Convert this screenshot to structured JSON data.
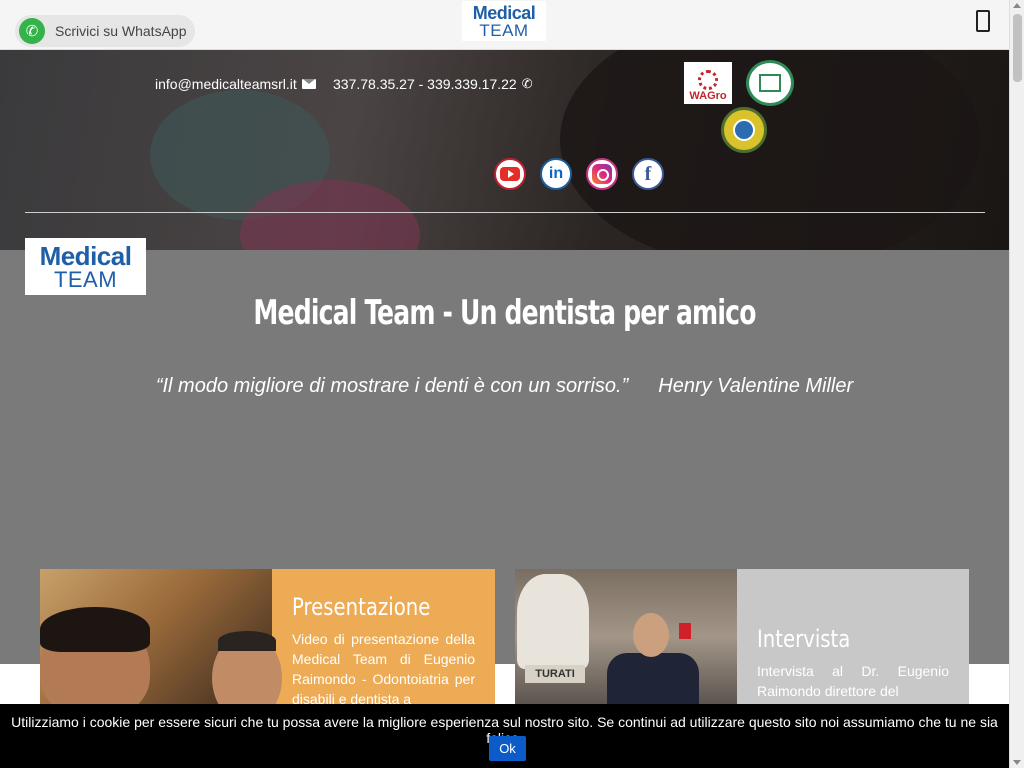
{
  "topbar": {
    "whatsapp_label": "Scrivici su WhatsApp",
    "logo": {
      "line1": "Medical",
      "line2": "TEAM"
    }
  },
  "hero": {
    "email": "info@medicalteamsrl.it",
    "phone": "337.78.35.27 - 339.339.17.22",
    "badges": {
      "wagro": "WAGro"
    },
    "social": [
      "youtube-icon",
      "linkedin-icon",
      "instagram-icon",
      "facebook-icon"
    ],
    "social_glyphs": {
      "linkedin": "in",
      "facebook": "f"
    }
  },
  "main": {
    "side_logo": {
      "line1": "Medical",
      "line2": "TEAM"
    },
    "title": "Medical Team - Un dentista per amico",
    "quote": "“Il modo migliore di mostrare i denti è con un sorriso.”",
    "quote_author": "Henry Valentine Miller"
  },
  "cards": [
    {
      "title": "Presentazione",
      "description": "Video di presentazione della Medical Team di Eugenio Raimondo - Odontoiatria per disabili e dentista a"
    },
    {
      "title": "Intervista",
      "description": "Intervista al Dr. Eugenio Raimondo direttore del",
      "plaque": "TURATI"
    }
  ],
  "cookie": {
    "text": "Utilizziamo i cookie per essere sicuri che tu possa avere la migliore esperienza sul nostro sito. Se continui ad utilizzare questo sito noi assumiamo che tu ne sia felice.",
    "ok_label": "Ok"
  },
  "colors": {
    "brand_blue": "#1f5fa8",
    "whatsapp_green": "#34b34a",
    "card_orange": "#ecab54",
    "card_gray": "#c8c8c8",
    "ok_button": "#0b5cc9"
  }
}
